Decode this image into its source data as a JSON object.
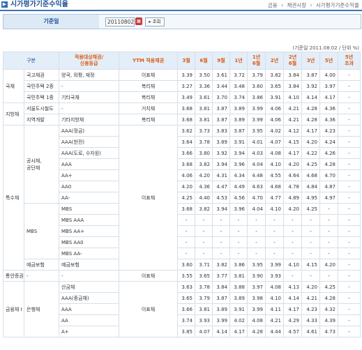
{
  "page": {
    "title": "시가평가기준수익율",
    "breadcrumb": [
      "금융",
      "채권시장",
      "시가평가기준수익율"
    ]
  },
  "search": {
    "label": "기준일",
    "date_value": "20110802",
    "button_label": "조회"
  },
  "table": {
    "unit_note": "(기준일 2011.08.02 / 단위 %)",
    "headers": {
      "category": "구분",
      "target": "적용대상채권/\n신용등급",
      "ytm": "YTM 적용채권",
      "maturities": [
        "3월",
        "6월",
        "9월",
        "1년",
        "1년\n6월",
        "2년",
        "2년\n6월",
        "3년",
        "5년",
        "5년\n초과"
      ]
    },
    "rows": [
      {
        "c1": "국채",
        "c2": "국고채권",
        "c3": "양곡, 외평, 재정",
        "ytm": "이표채",
        "v": [
          "3.39",
          "3.50",
          "3.61",
          "3.72",
          "3.79",
          "3.82",
          "3.84",
          "3.87",
          "4.00",
          "-"
        ]
      },
      {
        "c1": "",
        "c2": "국민주택 2종",
        "c3": "-",
        "ytm": "복리채",
        "v": [
          "3.27",
          "3.36",
          "3.44",
          "3.48",
          "3.60",
          "3.65",
          "3.84",
          "3.92",
          "3.97",
          "-"
        ]
      },
      {
        "c1": "",
        "c2": "국민주택 1종",
        "c3": "기타국채",
        "ytm": "복리채",
        "v": [
          "3.49",
          "3.61",
          "3.70",
          "3.74",
          "3.86",
          "3.91",
          "4.10",
          "4.14",
          "4.17",
          "-"
        ]
      },
      {
        "c1": "지방채",
        "c2": "서울도시철도",
        "c3": "-",
        "ytm": "거치채",
        "v": [
          "3.68",
          "3.81",
          "3.87",
          "3.89",
          "3.99",
          "4.06",
          "4.21",
          "4.28",
          "4.36",
          "-"
        ]
      },
      {
        "c1": "",
        "c2": "지역개발",
        "c3": "기타지방채",
        "ytm": "복리채",
        "v": [
          "3.68",
          "3.81",
          "3.87",
          "3.89",
          "3.99",
          "4.06",
          "4.21",
          "4.28",
          "4.36",
          "-"
        ]
      },
      {
        "c1": "특수채",
        "c2": "공사채,\n공단채",
        "c3": "AAA(정금)",
        "ytm": "",
        "v": [
          "3.62",
          "3.73",
          "3.83",
          "3.87",
          "3.95",
          "4.02",
          "4.12",
          "4.17",
          "4.23",
          "-"
        ]
      },
      {
        "c1": "",
        "c2": "",
        "c3": "AAA(한전)",
        "ytm": "",
        "v": [
          "3.64",
          "3.78",
          "3.89",
          "3.91",
          "4.01",
          "4.07",
          "4.15",
          "4.20",
          "4.24",
          "-"
        ]
      },
      {
        "c1": "",
        "c2": "",
        "c3": "AAA(도로, 수자원)",
        "ytm": "",
        "v": [
          "3.66",
          "3.80",
          "3.92",
          "3.94",
          "4.03",
          "4.08",
          "4.17",
          "4.22",
          "4.26",
          "-"
        ]
      },
      {
        "c1": "",
        "c2": "",
        "c3": "AAA",
        "ytm": "",
        "v": [
          "3.68",
          "3.82",
          "3.94",
          "3.96",
          "4.04",
          "4.10",
          "4.20",
          "4.25",
          "4.28",
          "-"
        ]
      },
      {
        "c1": "",
        "c2": "",
        "c3": "AA+",
        "ytm": "",
        "v": [
          "4.06",
          "4.20",
          "4.31",
          "4.34",
          "4.48",
          "4.55",
          "4.64",
          "4.68",
          "4.70",
          "-"
        ]
      },
      {
        "c1": "",
        "c2": "",
        "c3": "AA0",
        "ytm": "이표채",
        "v": [
          "4.20",
          "4.36",
          "4.47",
          "4.49",
          "4.63",
          "4.68",
          "4.78",
          "4.84",
          "4.87",
          "-"
        ]
      },
      {
        "c1": "",
        "c2": "",
        "c3": "AA-",
        "ytm": "",
        "v": [
          "4.25",
          "4.40",
          "4.53",
          "4.56",
          "4.70",
          "4.77",
          "4.89",
          "4.95",
          "4.97",
          "-"
        ]
      },
      {
        "c1": "",
        "c2": "MBS",
        "c3": "MBS",
        "ytm": "",
        "v": [
          "3.68",
          "3.82",
          "3.94",
          "3.96",
          "4.04",
          "4.10",
          "4.20",
          "4.25",
          "-",
          "-"
        ]
      },
      {
        "c1": "",
        "c2": "",
        "c3": "MBS AAA",
        "ytm": "",
        "v": [
          "-",
          "-",
          "-",
          "-",
          "-",
          "-",
          "-",
          "-",
          "-",
          "-"
        ]
      },
      {
        "c1": "",
        "c2": "",
        "c3": "MBS AA+",
        "ytm": "",
        "v": [
          "-",
          "-",
          "-",
          "-",
          "-",
          "-",
          "-",
          "-",
          "-",
          "-"
        ]
      },
      {
        "c1": "",
        "c2": "",
        "c3": "MBS AA0",
        "ytm": "",
        "v": [
          "-",
          "-",
          "-",
          "-",
          "-",
          "-",
          "-",
          "-",
          "-",
          "-"
        ]
      },
      {
        "c1": "",
        "c2": "",
        "c3": "MBS AA-",
        "ytm": "",
        "v": [
          "-",
          "-",
          "-",
          "-",
          "-",
          "-",
          "-",
          "-",
          "-",
          "-"
        ]
      },
      {
        "c1": "",
        "c2": "예금보험",
        "c3": "예금보험",
        "ytm": "",
        "v": [
          "3.60",
          "3.71",
          "3.82",
          "3.86",
          "3.95",
          "3.99",
          "4.10",
          "4.15",
          "4.20",
          "-"
        ]
      },
      {
        "c1": "통안증권",
        "c2": "-",
        "c3": "-",
        "ytm": "이표채",
        "v": [
          "3.55",
          "3.65",
          "3.77",
          "3.81",
          "3.90",
          "3.93",
          "-",
          "-",
          "-",
          "-"
        ]
      },
      {
        "c1": "금융채 I",
        "c2": "은행채",
        "c3": "산금채",
        "ytm": "",
        "v": [
          "3.63",
          "3.78",
          "3.84",
          "3.88",
          "3.97",
          "4.08",
          "4.13",
          "4.20",
          "4.25",
          "-"
        ]
      },
      {
        "c1": "",
        "c2": "",
        "c3": "AAA(중금채)",
        "ytm": "",
        "v": [
          "3.65",
          "3.79",
          "3.87",
          "3.89",
          "3.98",
          "4.10",
          "4.14",
          "4.21",
          "4.28",
          "-"
        ]
      },
      {
        "c1": "",
        "c2": "",
        "c3": "AAA",
        "ytm": "이표채",
        "v": [
          "3.66",
          "3.81",
          "3.89",
          "3.91",
          "3.99",
          "4.11",
          "4.17",
          "4.23",
          "4.32",
          "-"
        ]
      },
      {
        "c1": "",
        "c2": "",
        "c3": "AA",
        "ytm": "",
        "v": [
          "3.74",
          "3.93",
          "3.99",
          "4.02",
          "4.08",
          "4.21",
          "4.29",
          "4.33",
          "4.39",
          "-"
        ]
      },
      {
        "c1": "",
        "c2": "",
        "c3": "A+",
        "ytm": "",
        "v": [
          "3.85",
          "4.07",
          "4.14",
          "4.17",
          "4.28",
          "4.44",
          "4.57",
          "4.61",
          "4.73",
          "-"
        ]
      }
    ]
  }
}
